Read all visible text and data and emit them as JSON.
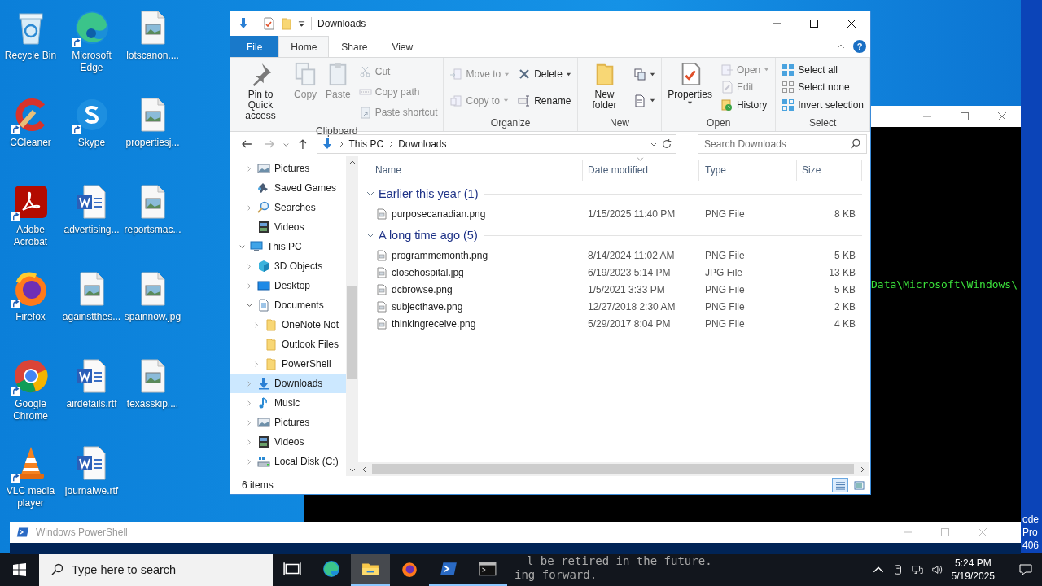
{
  "desktop": {
    "icons": [
      {
        "label": "Recycle Bin",
        "kind": "recycle",
        "shortcut": false
      },
      {
        "label": "CCleaner",
        "kind": "ccleaner",
        "shortcut": true
      },
      {
        "label": "Adobe Acrobat",
        "kind": "acrobat",
        "shortcut": true
      },
      {
        "label": "Firefox",
        "kind": "firefox",
        "shortcut": true
      },
      {
        "label": "Google Chrome",
        "kind": "chrome",
        "shortcut": true
      },
      {
        "label": "VLC media player",
        "kind": "vlc",
        "shortcut": true
      },
      {
        "label": "Microsoft Edge",
        "kind": "edge",
        "shortcut": true
      },
      {
        "label": "Skype",
        "kind": "skype",
        "shortcut": true
      },
      {
        "label": "advertising...",
        "kind": "word",
        "shortcut": false
      },
      {
        "label": "againstthes...",
        "kind": "image",
        "shortcut": false
      },
      {
        "label": "airdetails.rtf",
        "kind": "word",
        "shortcut": false
      },
      {
        "label": "journalwe.rtf",
        "kind": "word",
        "shortcut": false
      },
      {
        "label": "lotscanon....",
        "kind": "image",
        "shortcut": false
      },
      {
        "label": "propertiesj...",
        "kind": "image",
        "shortcut": false
      },
      {
        "label": "reportsmac...",
        "kind": "image",
        "shortcut": false
      },
      {
        "label": "spainnow.jpg",
        "kind": "image",
        "shortcut": false
      },
      {
        "label": "texasskip....",
        "kind": "image",
        "shortcut": false
      }
    ],
    "edge_text": [
      "ode",
      "Pro",
      "406"
    ]
  },
  "console": {
    "lines": [
      "Data\\Microsoft\\Windows\\"
    ]
  },
  "explorer": {
    "title": "Downloads",
    "tabs": [
      {
        "label": "File",
        "kind": "file",
        "selected": false
      },
      {
        "label": "Home",
        "kind": "tab",
        "selected": true
      },
      {
        "label": "Share",
        "kind": "tab",
        "selected": false
      },
      {
        "label": "View",
        "kind": "tab",
        "selected": false
      }
    ],
    "help": "?",
    "groups": [
      {
        "label": "Clipboard",
        "columns": [
          [
            {
              "label": "Pin to Quick access",
              "large": true,
              "disabled": false,
              "menu": false
            }
          ],
          [
            {
              "label": "Copy",
              "large": true,
              "disabled": true,
              "menu": false
            }
          ],
          [
            {
              "label": "Paste",
              "large": true,
              "disabled": true,
              "menu": false
            }
          ],
          [
            {
              "label": "Cut",
              "large": false,
              "disabled": true,
              "menu": false
            },
            {
              "label": "Copy path",
              "large": false,
              "disabled": true,
              "menu": false
            },
            {
              "label": "Paste shortcut",
              "large": false,
              "disabled": true,
              "menu": false
            }
          ]
        ]
      },
      {
        "label": "Organize",
        "columns": [
          [
            {
              "label": "Move to",
              "large": false,
              "disabled": true,
              "menu": true
            },
            {
              "label": "Copy to",
              "large": false,
              "disabled": true,
              "menu": true
            }
          ],
          [
            {
              "label": "Delete",
              "large": false,
              "disabled": false,
              "menu": true
            },
            {
              "label": "Rename",
              "large": false,
              "disabled": false,
              "menu": false
            }
          ]
        ]
      },
      {
        "label": "New",
        "columns": [
          [
            {
              "label": "New folder",
              "large": true,
              "disabled": false,
              "menu": false
            }
          ],
          [
            {
              "large": false,
              "disabled": false,
              "menu": true
            },
            {
              "large": false,
              "disabled": false,
              "menu": true
            }
          ]
        ]
      },
      {
        "label": "Open",
        "columns": [
          [
            {
              "label": "Properties",
              "large": true,
              "disabled": false,
              "menu": true
            }
          ],
          [
            {
              "label": "Open",
              "large": false,
              "disabled": true,
              "menu": true
            },
            {
              "label": "Edit",
              "large": false,
              "disabled": true,
              "menu": false
            },
            {
              "label": "History",
              "large": false,
              "disabled": false,
              "menu": false
            }
          ]
        ]
      },
      {
        "label": "Select",
        "columns": [
          [
            {
              "label": "Select all",
              "large": false,
              "disabled": false,
              "menu": false
            },
            {
              "label": "Select none",
              "large": false,
              "disabled": false,
              "menu": false
            },
            {
              "label": "Invert selection",
              "large": false,
              "disabled": false,
              "menu": false
            }
          ]
        ]
      }
    ],
    "crumbs": [
      "This PC",
      "Downloads"
    ],
    "search_placeholder": "Search Downloads",
    "nav": {
      "upper": [
        {
          "label": "Pictures",
          "kind": "pictures",
          "expandable": true,
          "expanded": false,
          "selected": false
        },
        {
          "label": "Saved Games",
          "kind": "games",
          "expandable": false,
          "expanded": false,
          "selected": false
        },
        {
          "label": "Searches",
          "kind": "search",
          "expandable": true,
          "expanded": false,
          "selected": false
        },
        {
          "label": "Videos",
          "kind": "videos",
          "expandable": false,
          "expanded": false,
          "selected": false
        }
      ],
      "tree": [
        {
          "label": "This PC",
          "kind": "pc",
          "expandable": true,
          "expanded": true,
          "selected": false,
          "children": [
            {
              "label": "3D Objects",
              "kind": "cube",
              "expandable": true,
              "expanded": false,
              "selected": false
            },
            {
              "label": "Desktop",
              "kind": "desktop",
              "expandable": true,
              "expanded": false,
              "selected": false
            },
            {
              "label": "Documents",
              "kind": "documents",
              "expandable": true,
              "expanded": true,
              "selected": false,
              "children": [
                {
                  "label": "OneNote Not",
                  "kind": "folder",
                  "expandable": true,
                  "expanded": false,
                  "selected": false
                },
                {
                  "label": "Outlook Files",
                  "kind": "folder",
                  "expandable": false,
                  "expanded": false,
                  "selected": false
                },
                {
                  "label": "PowerShell",
                  "kind": "folder",
                  "expandable": true,
                  "expanded": false,
                  "selected": false
                }
              ]
            },
            {
              "label": "Downloads",
              "kind": "downloads",
              "expandable": true,
              "expanded": false,
              "selected": true
            },
            {
              "label": "Music",
              "kind": "music",
              "expandable": true,
              "expanded": false,
              "selected": false
            },
            {
              "label": "Pictures",
              "kind": "pictures",
              "expandable": true,
              "expanded": false,
              "selected": false
            },
            {
              "label": "Videos",
              "kind": "videos",
              "expandable": true,
              "expanded": false,
              "selected": false
            },
            {
              "label": "Local Disk (C:)",
              "kind": "disk",
              "expandable": true,
              "expanded": false,
              "selected": false
            }
          ]
        }
      ]
    },
    "columns": [
      {
        "label": "Name",
        "sorted": false
      },
      {
        "label": "Date modified",
        "sorted": true
      },
      {
        "label": "Type",
        "sorted": false
      },
      {
        "label": "Size",
        "sorted": false
      }
    ],
    "file_groups": [
      {
        "title": "Earlier this year (1)",
        "expanded": true,
        "rows": [
          {
            "name": "purposecanadian.png",
            "date": "1/15/2025 11:40 PM",
            "type": "PNG File",
            "size": "8 KB"
          }
        ]
      },
      {
        "title": "A long time ago (5)",
        "expanded": true,
        "rows": [
          {
            "name": "programmemonth.png",
            "date": "8/14/2024 11:02 AM",
            "type": "PNG File",
            "size": "5 KB"
          },
          {
            "name": "closehospital.jpg",
            "date": "6/19/2023 5:14 PM",
            "type": "JPG File",
            "size": "13 KB"
          },
          {
            "name": "dcbrowse.png",
            "date": "1/5/2021 3:33 PM",
            "type": "PNG File",
            "size": "5 KB"
          },
          {
            "name": "subjecthave.png",
            "date": "12/27/2018 2:30 AM",
            "type": "PNG File",
            "size": "2 KB"
          },
          {
            "name": "thinkingreceive.png",
            "date": "5/29/2017 8:04 PM",
            "type": "PNG File",
            "size": "4 KB"
          }
        ]
      }
    ],
    "status": "6 items",
    "views": [
      {
        "kind": "details",
        "selected": true
      },
      {
        "kind": "tiles",
        "selected": false
      }
    ]
  },
  "powershell": {
    "title": "Windows PowerShell",
    "lines": [
      "l be retired in the future.",
      "ing forward."
    ]
  },
  "taskbar": {
    "search_placeholder": "Type here to search",
    "apps": [
      {
        "kind": "taskview",
        "running": false,
        "active": false
      },
      {
        "kind": "edge",
        "running": false,
        "active": false
      },
      {
        "kind": "explorer",
        "running": true,
        "active": true
      },
      {
        "kind": "firefox",
        "running": false,
        "active": false
      },
      {
        "kind": "powershell",
        "running": true,
        "active": false
      },
      {
        "kind": "cmd",
        "running": true,
        "active": false
      }
    ],
    "time": "5:24 PM",
    "date": "5/19/2025"
  }
}
